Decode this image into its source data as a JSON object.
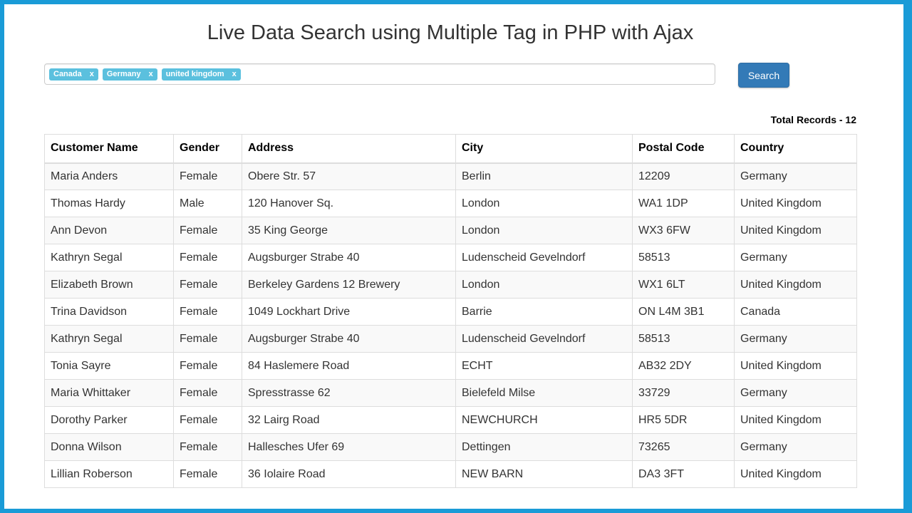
{
  "title": "Live Data Search using Multiple Tag in PHP with Ajax",
  "tags": [
    "Canada",
    "Germany",
    "united kingdom"
  ],
  "tag_remove_label": "x",
  "search_button_label": "Search",
  "total_records_label": "Total Records - 12",
  "colors": {
    "frame": "#1a9bd7",
    "tag": "#5bc0de",
    "button": "#337ab7"
  },
  "table": {
    "headers": [
      "Customer Name",
      "Gender",
      "Address",
      "City",
      "Postal Code",
      "Country"
    ],
    "rows": [
      [
        "Maria Anders",
        "Female",
        "Obere Str. 57",
        "Berlin",
        "12209",
        "Germany"
      ],
      [
        "Thomas Hardy",
        "Male",
        "120 Hanover Sq.",
        "London",
        "WA1 1DP",
        "United Kingdom"
      ],
      [
        "Ann Devon",
        "Female",
        "35 King George",
        "London",
        "WX3 6FW",
        "United Kingdom"
      ],
      [
        "Kathryn Segal",
        "Female",
        "Augsburger Strabe 40",
        "Ludenscheid Gevelndorf",
        "58513",
        "Germany"
      ],
      [
        "Elizabeth Brown",
        "Female",
        "Berkeley Gardens 12 Brewery",
        "London",
        "WX1 6LT",
        "United Kingdom"
      ],
      [
        "Trina Davidson",
        "Female",
        "1049 Lockhart Drive",
        "Barrie",
        "ON L4M 3B1",
        "Canada"
      ],
      [
        "Kathryn Segal",
        "Female",
        "Augsburger Strabe 40",
        "Ludenscheid Gevelndorf",
        "58513",
        "Germany"
      ],
      [
        "Tonia Sayre",
        "Female",
        "84 Haslemere Road",
        "ECHT",
        "AB32 2DY",
        "United Kingdom"
      ],
      [
        "Maria Whittaker",
        "Female",
        "Spresstrasse 62",
        "Bielefeld Milse",
        "33729",
        "Germany"
      ],
      [
        "Dorothy Parker",
        "Female",
        "32 Lairg Road",
        "NEWCHURCH",
        "HR5 5DR",
        "United Kingdom"
      ],
      [
        "Donna Wilson",
        "Female",
        "Hallesches Ufer 69",
        "Dettingen",
        "73265",
        "Germany"
      ],
      [
        "Lillian Roberson",
        "Female",
        "36 Iolaire Road",
        "NEW BARN",
        "DA3 3FT",
        "United Kingdom"
      ]
    ]
  }
}
